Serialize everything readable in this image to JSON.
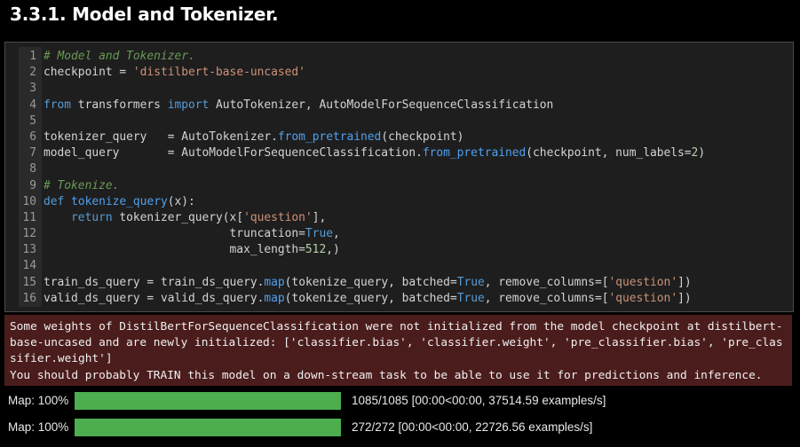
{
  "heading": "3.3.1. Model and Tokenizer.",
  "code_lines": [
    {
      "n": "1",
      "html": "<span class=\"cm\"># Model and Tokenizer.</span>"
    },
    {
      "n": "2",
      "html": "checkpoint <span class=\"op\">=</span> <span class=\"str\">'distilbert-base-uncased'</span>"
    },
    {
      "n": "3",
      "html": ""
    },
    {
      "n": "4",
      "html": "<span class=\"kw\">from</span> transformers <span class=\"kw\">import</span> AutoTokenizer, AutoModelForSequenceClassification"
    },
    {
      "n": "5",
      "html": ""
    },
    {
      "n": "6",
      "html": "tokenizer_query   <span class=\"op\">=</span> AutoTokenizer.<span class=\"fn\">from_pretrained</span>(checkpoint)"
    },
    {
      "n": "7",
      "html": "model_query       <span class=\"op\">=</span> AutoModelForSequenceClassification.<span class=\"fn\">from_pretrained</span>(checkpoint, num_labels<span class=\"op\">=</span><span class=\"num\">2</span>)"
    },
    {
      "n": "8",
      "html": ""
    },
    {
      "n": "9",
      "html": "<span class=\"cm\"># Tokenize.</span>"
    },
    {
      "n": "10",
      "html": "<span class=\"kw\">def</span> <span class=\"fn\">tokenize_query</span>(x):"
    },
    {
      "n": "11",
      "html": "    <span class=\"kw\">return</span> tokenizer_query(x[<span class=\"str\">'question'</span>],"
    },
    {
      "n": "12",
      "html": "                           truncation<span class=\"op\">=</span><span class=\"kw\">True</span>,"
    },
    {
      "n": "13",
      "html": "                           max_length<span class=\"op\">=</span><span class=\"num\">512</span>,)"
    },
    {
      "n": "14",
      "html": ""
    },
    {
      "n": "15",
      "html": "train_ds_query <span class=\"op\">=</span> train_ds_query.<span class=\"fn\">map</span>(tokenize_query, batched<span class=\"op\">=</span><span class=\"kw\">True</span>, remove_columns<span class=\"op\">=</span>[<span class=\"str\">'question'</span>])"
    },
    {
      "n": "16",
      "html": "valid_ds_query <span class=\"op\">=</span> valid_ds_query.<span class=\"fn\">map</span>(tokenize_query, batched<span class=\"op\">=</span><span class=\"kw\">True</span>, remove_columns<span class=\"op\">=</span>[<span class=\"str\">'question'</span>])"
    }
  ],
  "stderr_text": "Some weights of DistilBertForSequenceClassification were not initialized from the model checkpoint at distilbert-base-uncased and are newly initialized: ['classifier.bias', 'classifier.weight', 'pre_classifier.bias', 'pre_classifier.weight']\nYou should probably TRAIN this model on a down-stream task to be able to use it for predictions and inference.",
  "progress": [
    {
      "label": "Map: 100%",
      "fraction": 1.0,
      "stats": "1085/1085  [00:00<00:00,  37514.59  examples/s]"
    },
    {
      "label": "Map: 100%",
      "fraction": 1.0,
      "stats": "272/272  [00:00<00:00,  22726.56  examples/s]"
    }
  ],
  "colors": {
    "progress_fill": "#4cae4f",
    "stderr_bg": "#4b1c1c",
    "cell_bg": "#1e1e1e"
  }
}
